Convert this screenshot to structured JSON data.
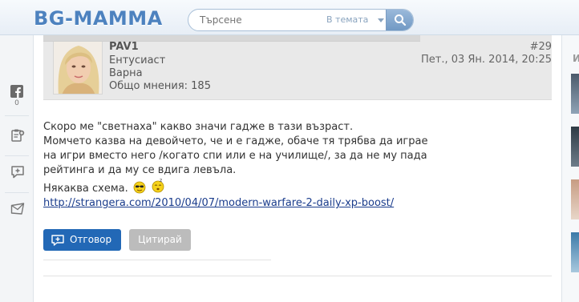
{
  "header": {
    "logo": "BG-MAMMA",
    "search_placeholder": "Търсене",
    "search_scope": "В темата"
  },
  "share": {
    "facebook_count": "0"
  },
  "right": {
    "letter": "И"
  },
  "post": {
    "author": "PAV1",
    "rank": "Ентусиаст",
    "city": "Варна",
    "posts_count": "Общо мнения: 185",
    "number": "#29",
    "date": "Пет., 03 Ян. 2014, 20:25",
    "lines": [
      "Скоро ме \"светнаха\" какво значи гадже в тази възраст.",
      "Момчето казва на девойчето, че и е гадже, обаче тя трябва да играе",
      "на игри вместо него /когато спи или е на училище/, за да не му пада",
      "рейтинга и да му се вдига левъла.",
      "Някаква схема."
    ],
    "link": "http://strangera.com/2010/04/07/modern-warfare-2-daily-xp-boost/",
    "reply_label": "Отговор",
    "quote_label": "Цитирай"
  },
  "colors": {
    "accent": "#2268b6",
    "logo": "#4d82bf",
    "link": "#1a3c8c"
  }
}
